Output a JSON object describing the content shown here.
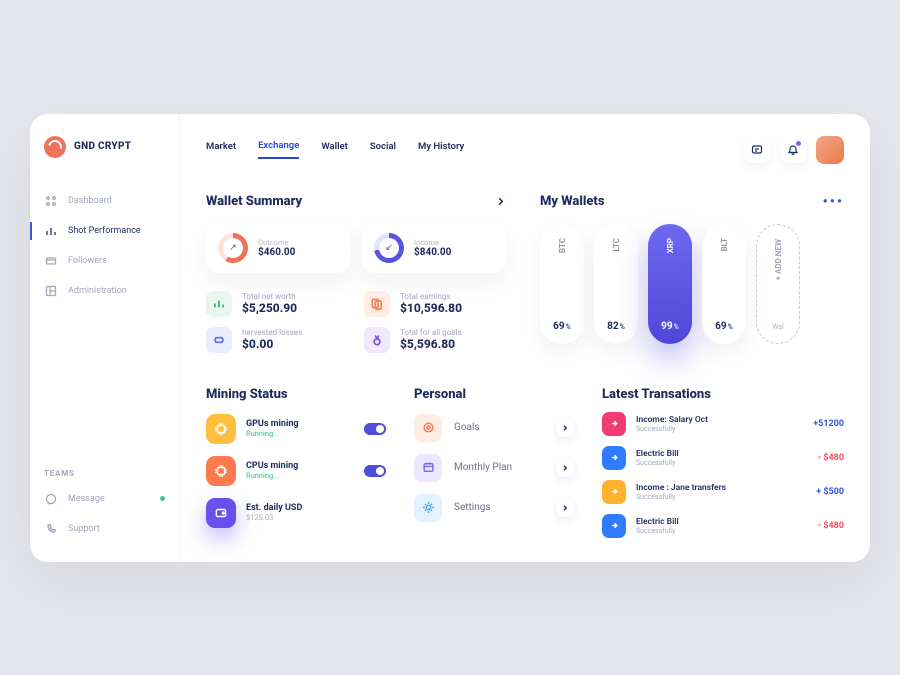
{
  "brand": "GND CRYPT",
  "sidebar": {
    "items": [
      {
        "label": "Dashboard"
      },
      {
        "label": "Shot Performance"
      },
      {
        "label": "Followers"
      },
      {
        "label": "Administration"
      }
    ],
    "teams_label": "TEAMS",
    "footer": [
      {
        "label": "Message"
      },
      {
        "label": "Support"
      }
    ]
  },
  "tabs": [
    "Market",
    "Exchange",
    "Wallet",
    "Social",
    "My History"
  ],
  "active_tab": "Exchange",
  "summary": {
    "title": "Wallet Summary",
    "outcome": {
      "label": "Outcome",
      "value": "$460.00"
    },
    "income": {
      "label": "Income",
      "value": "$840.00"
    },
    "stats": [
      {
        "label": "Total net worth",
        "value": "$5,250.90",
        "color": "#e7f7ed",
        "iconColor": "#24b765"
      },
      {
        "label": "Total earnings",
        "value": "$10,596.80",
        "color": "#ffece3",
        "iconColor": "#ff7a4c"
      },
      {
        "label": "harvested losses",
        "value": "$0.00",
        "color": "#e9edff",
        "iconColor": "#5a6fe6"
      },
      {
        "label": "Total for all goals",
        "value": "$5,596.80",
        "color": "#f0e8ff",
        "iconColor": "#7a4ef0"
      }
    ]
  },
  "wallets": {
    "title": "My Wallets",
    "items": [
      {
        "name": "BTC",
        "pct": "69"
      },
      {
        "name": "LTC",
        "pct": "82"
      },
      {
        "name": "XRP",
        "pct": "99",
        "active": true
      },
      {
        "name": "BLT",
        "pct": "69"
      }
    ],
    "add_label": "+ ADD NEW",
    "add_foot": "Wal"
  },
  "mining": {
    "title": "Mining Status",
    "items": [
      {
        "title": "GPUs mining",
        "sub": "Running...",
        "toggle": true,
        "color": "yellow"
      },
      {
        "title": "CPUs mining",
        "sub": "Running...",
        "toggle": true,
        "color": "orange"
      },
      {
        "title": "Est. daily USD",
        "sub": "$125.03",
        "toggle": false,
        "color": "purple"
      }
    ]
  },
  "personal": {
    "title": "Personal",
    "items": [
      {
        "label": "Goals",
        "bg": "#ffece3",
        "fg": "#ff7a4c"
      },
      {
        "label": "Monthly Plan",
        "bg": "#ece7ff",
        "fg": "#7a67ef"
      },
      {
        "label": "Settings",
        "bg": "#e2f2ff",
        "fg": "#3aa4ef"
      }
    ]
  },
  "transactions": {
    "title": "Latest Transations",
    "items": [
      {
        "title": "Income: Salary Oct",
        "sub": "Successfully",
        "amt": "+51200",
        "cls": "pos",
        "bg": "#ef3d74"
      },
      {
        "title": "Electric Bill",
        "sub": "Successfully",
        "amt": "- $480",
        "cls": "neg",
        "bg": "#2f7bff"
      },
      {
        "title": "Income : Jane transfers",
        "sub": "Successfully",
        "amt": "+ $500",
        "cls": "pos",
        "bg": "#ffb02e"
      },
      {
        "title": "Electric Bill",
        "sub": "Successfully",
        "amt": "- $480",
        "cls": "neg",
        "bg": "#2f7bff"
      }
    ]
  }
}
